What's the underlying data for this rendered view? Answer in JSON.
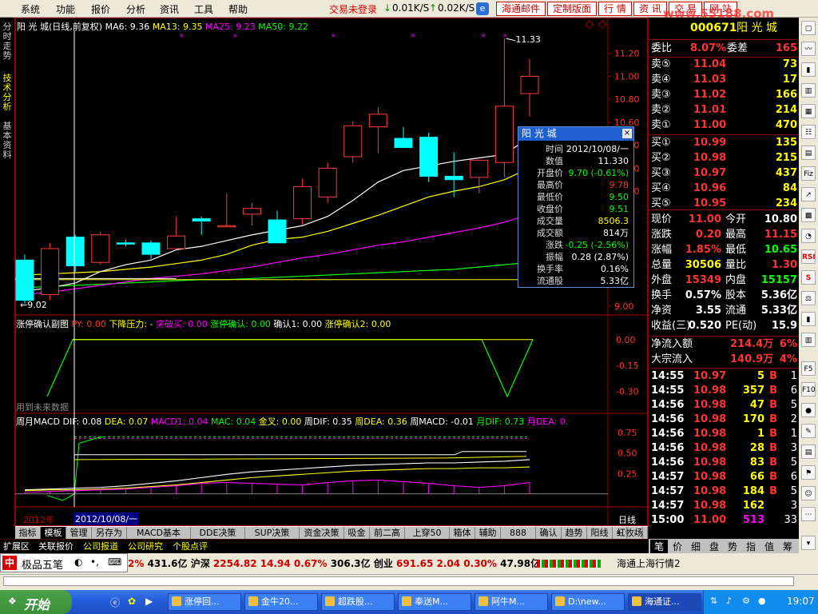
{
  "menubar": {
    "items": [
      "系统",
      "功能",
      "报价",
      "分析",
      "资讯",
      "工具",
      "帮助"
    ],
    "trade_status": "交易未登录",
    "down_speed": "0.01K/S",
    "up_speed": "0.02K/S",
    "buttons": [
      "海通邮件",
      "定制版面",
      "行 情",
      "资 讯",
      "交 易",
      "网 站"
    ],
    "watermark": "www.55188.com"
  },
  "side_tabs": [
    "分时走势",
    "技术分析",
    "基本资料"
  ],
  "main_chart": {
    "legend_title": "阳 光 城(日线,前复权)",
    "ma_legend": [
      {
        "text": "MA6: 9.36",
        "color": "#ffffff"
      },
      {
        "text": "MA13: 9.35",
        "color": "#ffff00"
      },
      {
        "text": "MA25: 9.23",
        "color": "#ff00ff"
      },
      {
        "text": "MA50: 9.22",
        "color": "#00ff00"
      }
    ],
    "price_ticks": [
      "11.20",
      "11.00",
      "10.80",
      "10.60",
      "10.40",
      "10.20",
      "10.00",
      "9.80",
      "9.60",
      "9.40",
      "9.20",
      "9.00"
    ],
    "high_label": "11.33",
    "low_label": "9.02",
    "series_colors": {
      "up": "#ff3c3c",
      "down": "#00ffff",
      "ma6": "#ffffff",
      "ma13": "#ffff00",
      "ma25": "#ff00ff",
      "ma50": "#00ff00"
    }
  },
  "chart_data": [
    {
      "type": "candlestick",
      "title": "阳 光 城(日线,前复权)",
      "ylim": [
        8.95,
        11.4
      ],
      "candles": [
        {
          "o": 9.4,
          "h": 9.45,
          "l": 9.02,
          "c": 9.05
        },
        {
          "o": 9.1,
          "h": 9.55,
          "l": 9.05,
          "c": 9.5
        },
        {
          "o": 9.6,
          "h": 9.62,
          "l": 9.3,
          "c": 9.35
        },
        {
          "o": 9.38,
          "h": 9.65,
          "l": 9.36,
          "c": 9.62
        },
        {
          "o": 9.55,
          "h": 9.58,
          "l": 9.52,
          "c": 9.54
        },
        {
          "o": 9.55,
          "h": 9.57,
          "l": 9.41,
          "c": 9.45
        },
        {
          "o": 9.5,
          "h": 9.78,
          "l": 9.5,
          "c": 9.61
        },
        {
          "o": 9.76,
          "h": 9.78,
          "l": 9.62,
          "c": 9.74
        },
        {
          "o": 9.7,
          "h": 9.98,
          "l": 9.7,
          "c": 9.7
        },
        {
          "o": 9.8,
          "h": 9.9,
          "l": 9.7,
          "c": 9.85
        },
        {
          "o": 9.75,
          "h": 9.83,
          "l": 9.55,
          "c": 9.55
        },
        {
          "o": 9.76,
          "h": 10.11,
          "l": 9.71,
          "c": 10.04
        },
        {
          "o": 9.95,
          "h": 10.25,
          "l": 9.9,
          "c": 10.2
        },
        {
          "o": 10.3,
          "h": 10.61,
          "l": 10.25,
          "c": 10.57
        },
        {
          "o": 10.56,
          "h": 10.73,
          "l": 10.33,
          "c": 10.67
        },
        {
          "o": 10.46,
          "h": 10.56,
          "l": 10.38,
          "c": 10.38
        },
        {
          "o": 10.47,
          "h": 10.51,
          "l": 10.08,
          "c": 10.13
        },
        {
          "o": 10.13,
          "h": 10.34,
          "l": 9.95,
          "c": 10.1
        },
        {
          "o": 10.12,
          "h": 10.27,
          "l": 9.98,
          "c": 10.27
        },
        {
          "o": 10.25,
          "h": 11.33,
          "l": 10.12,
          "c": 10.74
        },
        {
          "o": 10.85,
          "h": 11.15,
          "l": 10.65,
          "c": 11.0
        }
      ],
      "ma6": [
        9.13,
        9.16,
        9.2,
        9.3,
        9.36,
        9.4,
        9.49,
        9.52,
        9.57,
        9.62,
        9.66,
        9.7,
        9.78,
        9.92,
        10.08,
        10.18,
        10.22,
        10.26,
        10.29,
        10.32,
        10.47
      ],
      "ma13": [
        9.27,
        9.28,
        9.29,
        9.3,
        9.32,
        9.34,
        9.37,
        9.4,
        9.45,
        9.53,
        9.58,
        9.6,
        9.65,
        9.72,
        9.79,
        9.87,
        9.95,
        10.0,
        10.04,
        10.1,
        10.2
      ],
      "ma25": [
        9.1,
        9.12,
        9.15,
        9.18,
        9.21,
        9.24,
        9.26,
        9.28,
        9.31,
        9.34,
        9.38,
        9.42,
        9.45,
        9.49,
        9.53,
        9.56,
        9.6,
        9.64,
        9.68,
        9.73,
        9.8
      ],
      "ma50": [
        9.16,
        9.17,
        9.18,
        9.19,
        9.2,
        9.21,
        9.22,
        9.23,
        9.23,
        9.24,
        9.25,
        9.26,
        9.27,
        9.28,
        9.29,
        9.3,
        9.31,
        9.32,
        9.34,
        9.36,
        9.38
      ]
    },
    {
      "type": "line",
      "title": "涨停确认副图",
      "ylim": [
        -0.4,
        0.05
      ],
      "ticks": [
        "0.00",
        "-0.15",
        "-0.30"
      ],
      "values": [
        -0.33,
        0.0,
        0.0,
        0.0,
        0.0,
        0.0,
        0.0,
        0.0,
        0.0,
        0.0,
        0.0,
        0.0,
        0.0,
        0.0,
        0.0,
        0.0,
        0.0,
        0.0,
        -0.33,
        0.0
      ]
    },
    {
      "type": "line",
      "title": "周月MACD",
      "ylim": [
        -0.1,
        0.85
      ],
      "ticks": [
        "0.75",
        "0.50",
        "0.25"
      ],
      "series": [
        {
          "name": "DIF",
          "values": [
            0.05,
            0.06,
            0.07,
            0.08,
            0.1,
            0.13,
            0.16,
            0.2,
            0.24,
            0.27,
            0.29,
            0.31,
            0.33,
            0.35,
            0.36,
            0.37,
            0.38,
            0.38,
            0.39,
            0.4,
            0.42
          ]
        },
        {
          "name": "DEA",
          "values": [
            0.04,
            0.05,
            0.05,
            0.06,
            0.07,
            0.09,
            0.11,
            0.14,
            0.17,
            0.2,
            0.22,
            0.24,
            0.26,
            0.28,
            0.29,
            0.3,
            0.31,
            0.31,
            0.32,
            0.32,
            0.33
          ]
        },
        {
          "name": "MACD",
          "values": [
            0.02,
            0.03,
            0.04,
            0.05,
            0.06,
            0.08,
            0.1,
            0.13,
            0.14,
            0.13,
            0.12,
            0.11,
            0.14,
            0.16,
            0.17,
            0.15,
            0.13,
            0.1,
            0.08,
            0.1,
            0.14
          ]
        }
      ]
    }
  ],
  "sub1": {
    "legend": [
      {
        "text": "涨停确认副图",
        "color": "#ffffff"
      },
      {
        "text": "PY: 0.00",
        "color": "#ff3333"
      },
      {
        "text": "下降压力: -",
        "color": "#ffff00"
      },
      {
        "text": "突破买: 0.00",
        "color": "#ff00ff"
      },
      {
        "text": "涨停确认: 0.00",
        "color": "#00ff00"
      },
      {
        "text": "确认1: 0.00",
        "color": "#ffffff"
      },
      {
        "text": "涨停确认2: 0.00",
        "color": "#ffff00"
      }
    ],
    "note": "用到未来数据"
  },
  "sub2": {
    "legend": [
      {
        "text": "周月MACD",
        "color": "#ffffff"
      },
      {
        "text": "DIF: 0.08",
        "color": "#ffffff"
      },
      {
        "text": "DEA: 0.07",
        "color": "#ffff00"
      },
      {
        "text": "MACD1: 0.04",
        "color": "#ff00ff"
      },
      {
        "text": "MAC: 0.04",
        "color": "#00ff00"
      },
      {
        "text": "金叉: 0.00",
        "color": "#ffff00"
      },
      {
        "text": "周DIF: 0.35",
        "color": "#ffffff"
      },
      {
        "text": "周DEA: 0.36",
        "color": "#ffff00"
      },
      {
        "text": "周MACD: -0.01",
        "color": "#ffffff"
      },
      {
        "text": "月DIF: 0.73",
        "color": "#00ff00"
      },
      {
        "text": "月DEA: 0.",
        "color": "#ff00ff"
      }
    ]
  },
  "date_axis": {
    "year": "2012年",
    "cursor_date": "2012/10/08/一",
    "period": "日线"
  },
  "popup": {
    "title": "阳 光 城",
    "close": "×",
    "rows": [
      {
        "label": "时间",
        "value": "2012/10/08/一",
        "color": "#ffffff"
      },
      {
        "label": "数值",
        "value": "11.330",
        "color": "#ffffff"
      },
      {
        "label": "开盘价",
        "value": "9.70 (-0.61%)",
        "color": "#00ff00"
      },
      {
        "label": "最高价",
        "value": "9.78",
        "color": "#ff3333"
      },
      {
        "label": "最低价",
        "value": "9.50",
        "color": "#00ff00"
      },
      {
        "label": "收盘价",
        "value": "9.51",
        "color": "#00ff00"
      },
      {
        "label": "成交量",
        "value": "8506.3",
        "color": "#ffff00"
      },
      {
        "label": "成交额",
        "value": "814万",
        "color": "#ffffff"
      },
      {
        "label": "涨跌",
        "value": "-0.25 (-2.56%)",
        "color": "#00ff00"
      },
      {
        "label": "振幅",
        "value": "0.28 (2.87%)",
        "color": "#ffffff"
      },
      {
        "label": "换手率",
        "value": "0.16%",
        "color": "#ffffff"
      },
      {
        "label": "流通股",
        "value": "5.33亿",
        "color": "#ffffff"
      }
    ]
  },
  "bottom_tabs": [
    "指标",
    "模板",
    "管理",
    "另存为",
    "MACD基本",
    "DDE决策",
    "SUP决策",
    "资金决策",
    "吸金",
    "前二高",
    "上穿50",
    "箱体",
    "辅助",
    "888",
    "确认",
    "趋势",
    "阳线",
    "红牧场",
    "西电"
  ],
  "sub_tabs": [
    "扩展区",
    "关联报价",
    "公司报道",
    "公司研究",
    "个股点评"
  ],
  "quote": {
    "code": "000671",
    "name": "阳 光 城",
    "weibi_label": "委比",
    "weibi": "8.07%",
    "weicha_label": "委差",
    "weicha": "165",
    "asks": [
      {
        "label": "卖⑤",
        "price": "11.04",
        "vol": "73"
      },
      {
        "label": "卖④",
        "price": "11.03",
        "vol": "17"
      },
      {
        "label": "卖③",
        "price": "11.02",
        "vol": "166"
      },
      {
        "label": "卖②",
        "price": "11.01",
        "vol": "214"
      },
      {
        "label": "卖①",
        "price": "11.00",
        "vol": "470"
      }
    ],
    "bids": [
      {
        "label": "买①",
        "price": "10.99",
        "vol": "135"
      },
      {
        "label": "买②",
        "price": "10.98",
        "vol": "215"
      },
      {
        "label": "买③",
        "price": "10.97",
        "vol": "437"
      },
      {
        "label": "买④",
        "price": "10.96",
        "vol": "84"
      },
      {
        "label": "买⑤",
        "price": "10.95",
        "vol": "234"
      }
    ],
    "stats": [
      {
        "l1": "现价",
        "v1": "11.00",
        "c1": "#ff3333",
        "l2": "今开",
        "v2": "10.80",
        "c2": "#ffffff"
      },
      {
        "l1": "涨跌",
        "v1": "0.20",
        "c1": "#ff3333",
        "l2": "最高",
        "v2": "11.15",
        "c2": "#ff3333"
      },
      {
        "l1": "涨幅",
        "v1": "1.85%",
        "c1": "#ff3333",
        "l2": "最低",
        "v2": "10.65",
        "c2": "#00ff00"
      },
      {
        "l1": "总量",
        "v1": "30506",
        "c1": "#ffff00",
        "l2": "量比",
        "v2": "1.30",
        "c2": "#ff3333"
      },
      {
        "l1": "外盘",
        "v1": "15349",
        "c1": "#ff3333",
        "l2": "内盘",
        "v2": "15157",
        "c2": "#00ff00"
      },
      {
        "l1": "换手",
        "v1": "0.57%",
        "c1": "#ffffff",
        "l2": "股本",
        "v2": "5.36亿",
        "c2": "#ffffff"
      },
      {
        "l1": "净资",
        "v1": "3.55",
        "c1": "#ffffff",
        "l2": "流通",
        "v2": "5.33亿",
        "c2": "#ffffff"
      },
      {
        "l1": "收益(三)",
        "v1": "0.520",
        "c1": "#ffffff",
        "l2": "PE(动)",
        "v2": "15.9",
        "c2": "#ffffff"
      }
    ],
    "flows": [
      {
        "label": "净流入额",
        "value": "214.4万",
        "pct": "6%"
      },
      {
        "label": "大宗流入",
        "value": "140.9万",
        "pct": "4%"
      }
    ],
    "ticks": [
      {
        "t": "14:55",
        "p": "10.97",
        "v": "5",
        "d": "B",
        "n": "1"
      },
      {
        "t": "14:55",
        "p": "10.98",
        "v": "357",
        "d": "B",
        "n": "6"
      },
      {
        "t": "14:56",
        "p": "10.98",
        "v": "47",
        "d": "B",
        "n": "5"
      },
      {
        "t": "14:56",
        "p": "10.98",
        "v": "170",
        "d": "B",
        "n": "2"
      },
      {
        "t": "14:56",
        "p": "10.98",
        "v": "1",
        "d": "B",
        "n": "1"
      },
      {
        "t": "14:56",
        "p": "10.98",
        "v": "28",
        "d": "B",
        "n": "3"
      },
      {
        "t": "14:56",
        "p": "10.98",
        "v": "83",
        "d": "B",
        "n": "5"
      },
      {
        "t": "14:57",
        "p": "10.98",
        "v": "66",
        "d": "B",
        "n": "6"
      },
      {
        "t": "14:57",
        "p": "10.98",
        "v": "184",
        "d": "B",
        "n": "5"
      },
      {
        "t": "14:57",
        "p": "10.98",
        "v": "162",
        "d": "",
        "n": "3"
      },
      {
        "t": "15:00",
        "p": "11.00",
        "v": "513",
        "d": "",
        "n": "33"
      }
    ],
    "bottom_tabs": [
      "笔",
      "价",
      "细",
      "盘",
      "势",
      "指",
      "值",
      "筹"
    ]
  },
  "right_icons": [
    "RSI",
    "S",
    "F5",
    "F10"
  ],
  "ticker": {
    "ime": "极品五笔",
    "items": [
      {
        "text": "2%",
        "color": "#d00000"
      },
      {
        "text": "431.6亿",
        "color": "#000000"
      },
      {
        "text": "沪深",
        "color": "#000000"
      },
      {
        "text": "2254.82",
        "color": "#d00000"
      },
      {
        "text": "14.94",
        "color": "#d00000"
      },
      {
        "text": "0.67%",
        "color": "#d00000"
      },
      {
        "text": "306.3亿",
        "color": "#000000"
      },
      {
        "text": "创业",
        "color": "#000000"
      },
      {
        "text": "691.65",
        "color": "#d00000"
      },
      {
        "text": "2.04",
        "color": "#d00000"
      },
      {
        "text": "0.30%",
        "color": "#d00000"
      },
      {
        "text": "47.98亿",
        "color": "#000000"
      }
    ],
    "status": "海通上海行情2"
  },
  "taskbar": {
    "start": "开始",
    "tasks": [
      "涨停回...",
      "金牛20...",
      "超跌股...",
      "奉送M...",
      "阿牛M...",
      "D:\\new...",
      "海通证..."
    ],
    "clock": "19:07"
  }
}
